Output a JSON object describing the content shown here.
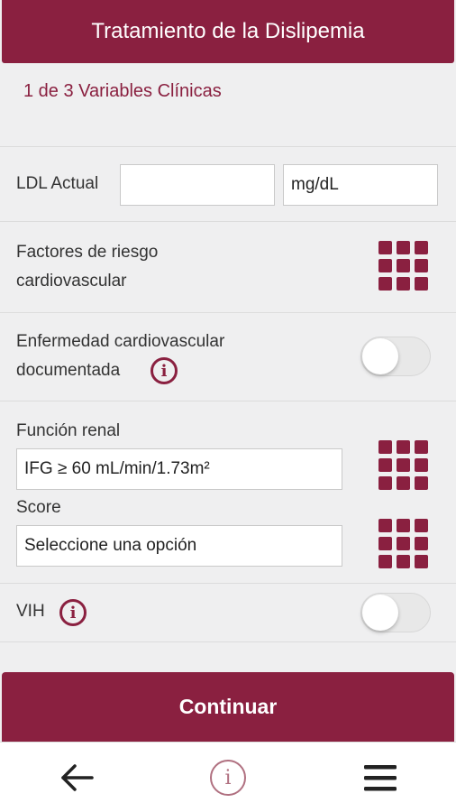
{
  "header": {
    "title": "Tratamiento de la Dislipemia"
  },
  "step": {
    "title": "1 de 3 Variables Clínicas"
  },
  "ldl": {
    "label": "LDL Actual",
    "value": "",
    "unit": "mg/dL"
  },
  "risk_factors": {
    "label_line1": "Factores de riesgo",
    "label_line2": "cardiovascular",
    "icon": "grid-icon"
  },
  "cv_disease": {
    "label_line1": "Enfermedad cardiovascular",
    "label_line2": "documentada",
    "info_icon": "info-icon",
    "enabled": false
  },
  "renal": {
    "label": "Función renal",
    "value": "IFG ≥ 60 mL/min/1.73m²"
  },
  "score": {
    "label": "Score",
    "value": "Seleccione una opción"
  },
  "vih": {
    "label": "VIH",
    "info_icon": "info-icon",
    "enabled": false
  },
  "continue": {
    "label": "Continuar"
  },
  "bottom_nav": {
    "info_glyph": "i"
  },
  "colors": {
    "accent": "#8a2040",
    "background": "#efeff0"
  }
}
